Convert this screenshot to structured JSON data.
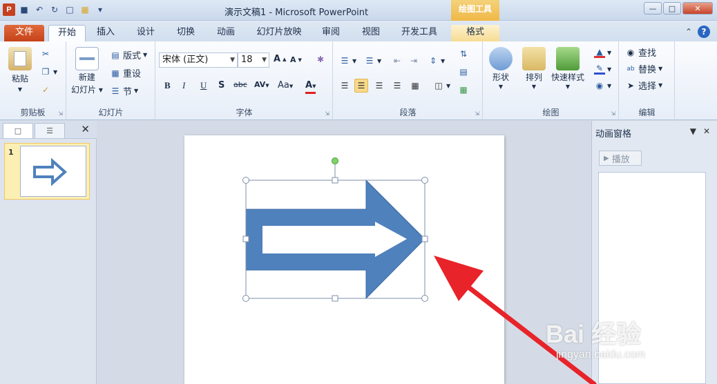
{
  "window": {
    "title": "演示文稿1 - Microsoft PowerPoint",
    "context_tools": "绘图工具"
  },
  "tabs": [
    "文件",
    "开始",
    "插入",
    "设计",
    "切换",
    "动画",
    "幻灯片放映",
    "审阅",
    "视图",
    "开发工具",
    "格式"
  ],
  "active_tab": "开始",
  "ribbon": {
    "clipboard": {
      "paste": "粘贴",
      "label": "剪贴板"
    },
    "slides": {
      "new_slide_1": "新建",
      "new_slide_2": "幻灯片",
      "layout": "版式",
      "reset": "重设",
      "section": "节",
      "label": "幻灯片"
    },
    "font": {
      "font_name": "宋体 (正文)",
      "font_size": "18",
      "bold": "B",
      "italic": "I",
      "underline": "U",
      "shadow": "S",
      "strike": "abc",
      "spacing": "AV",
      "case": "Aa",
      "color": "A",
      "label": "字体"
    },
    "paragraph": {
      "label": "段落"
    },
    "drawing": {
      "shapes": "形状",
      "arrange": "排列",
      "quick_styles": "快速样式",
      "label": "绘图"
    },
    "editing": {
      "find": "查找",
      "replace": "替换",
      "select": "选择",
      "label": "编辑"
    }
  },
  "slides_panel": {
    "slide_number": "1"
  },
  "animation_pane": {
    "title": "动画窗格",
    "play": "播放"
  },
  "watermark": {
    "text": "Bai 经验",
    "url": "jingyan.baidu.com"
  },
  "colors": {
    "shape_fill": "#4f81bd",
    "annotation_arrow": "#e8232a",
    "file_tab": "#c6421a"
  }
}
